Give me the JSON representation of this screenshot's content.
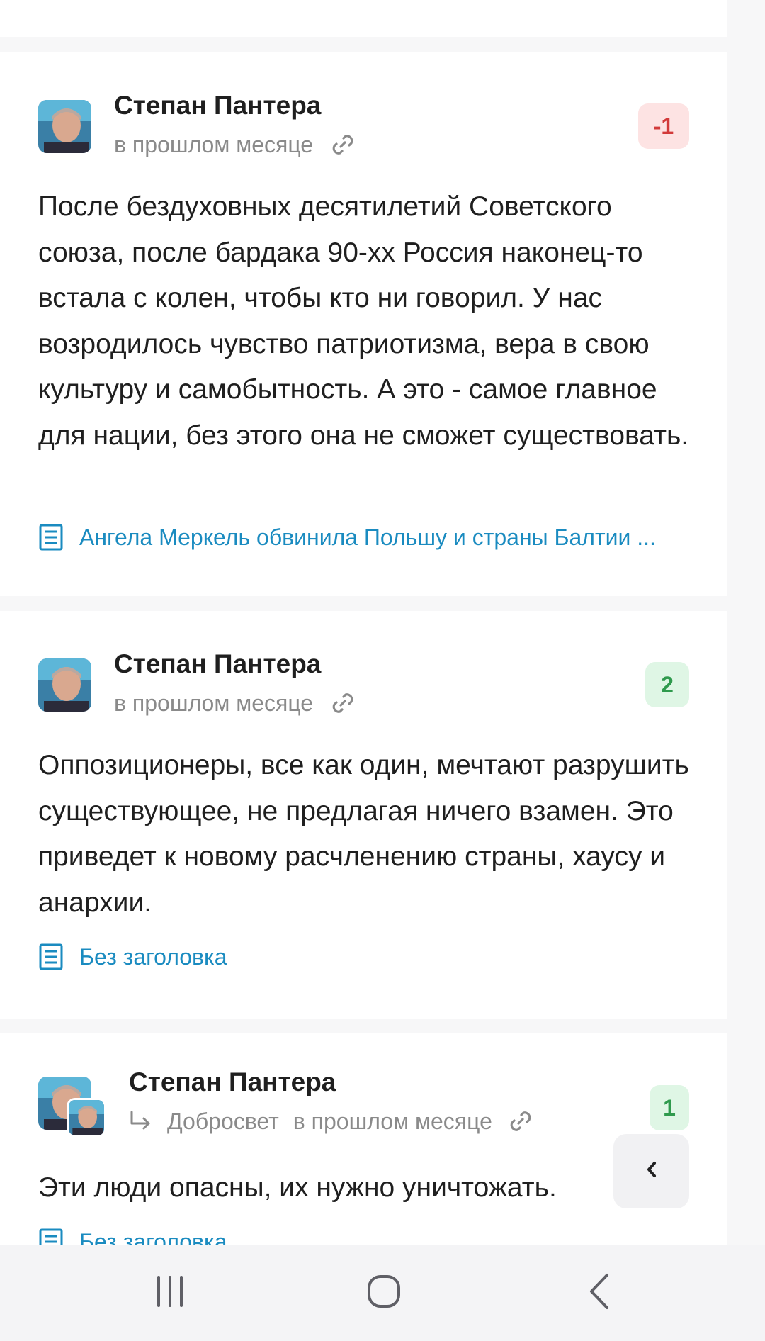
{
  "comments": [
    {
      "author": "Степан Пантера",
      "time": "в прошлом месяце",
      "score": "-1",
      "text": "После бездуховных десятилетий Советского союза, после бардака 90-хх Россия наконец-то встала с колен, чтобы кто ни говорил. У нас возродилось чувство патриотизма, вера в свою культуру и самобытность. А это - самое главное для нации, без этого она не сможет существовать.",
      "article": "Ангела Меркель обвинила Польшу и страны Балтии ..."
    },
    {
      "author": "Степан Пантера",
      "time": "в прошлом месяце",
      "score": "2",
      "text": "Оппозиционеры, все как один, мечтают разрушить существующее, не предлагая ничего взамен. Это приведет к новому расчленению страны, хаусу и анархии.",
      "article": "Без заголовка"
    },
    {
      "author": "Степан Пантера",
      "reply_to": "Добросвет",
      "time": "в прошлом месяце",
      "score": "1",
      "text": "Эти люди опасны, их нужно уничтожать.",
      "article": "Без заголовка"
    }
  ],
  "fab": {
    "icon": "chevron-left-icon"
  },
  "navbar": {
    "recents_icon": "recents-icon",
    "home_icon": "home-icon",
    "back_icon": "back-icon"
  },
  "colors": {
    "link": "#1a8bc0",
    "negative": "#d23a3a",
    "positive": "#2f9a4d"
  }
}
